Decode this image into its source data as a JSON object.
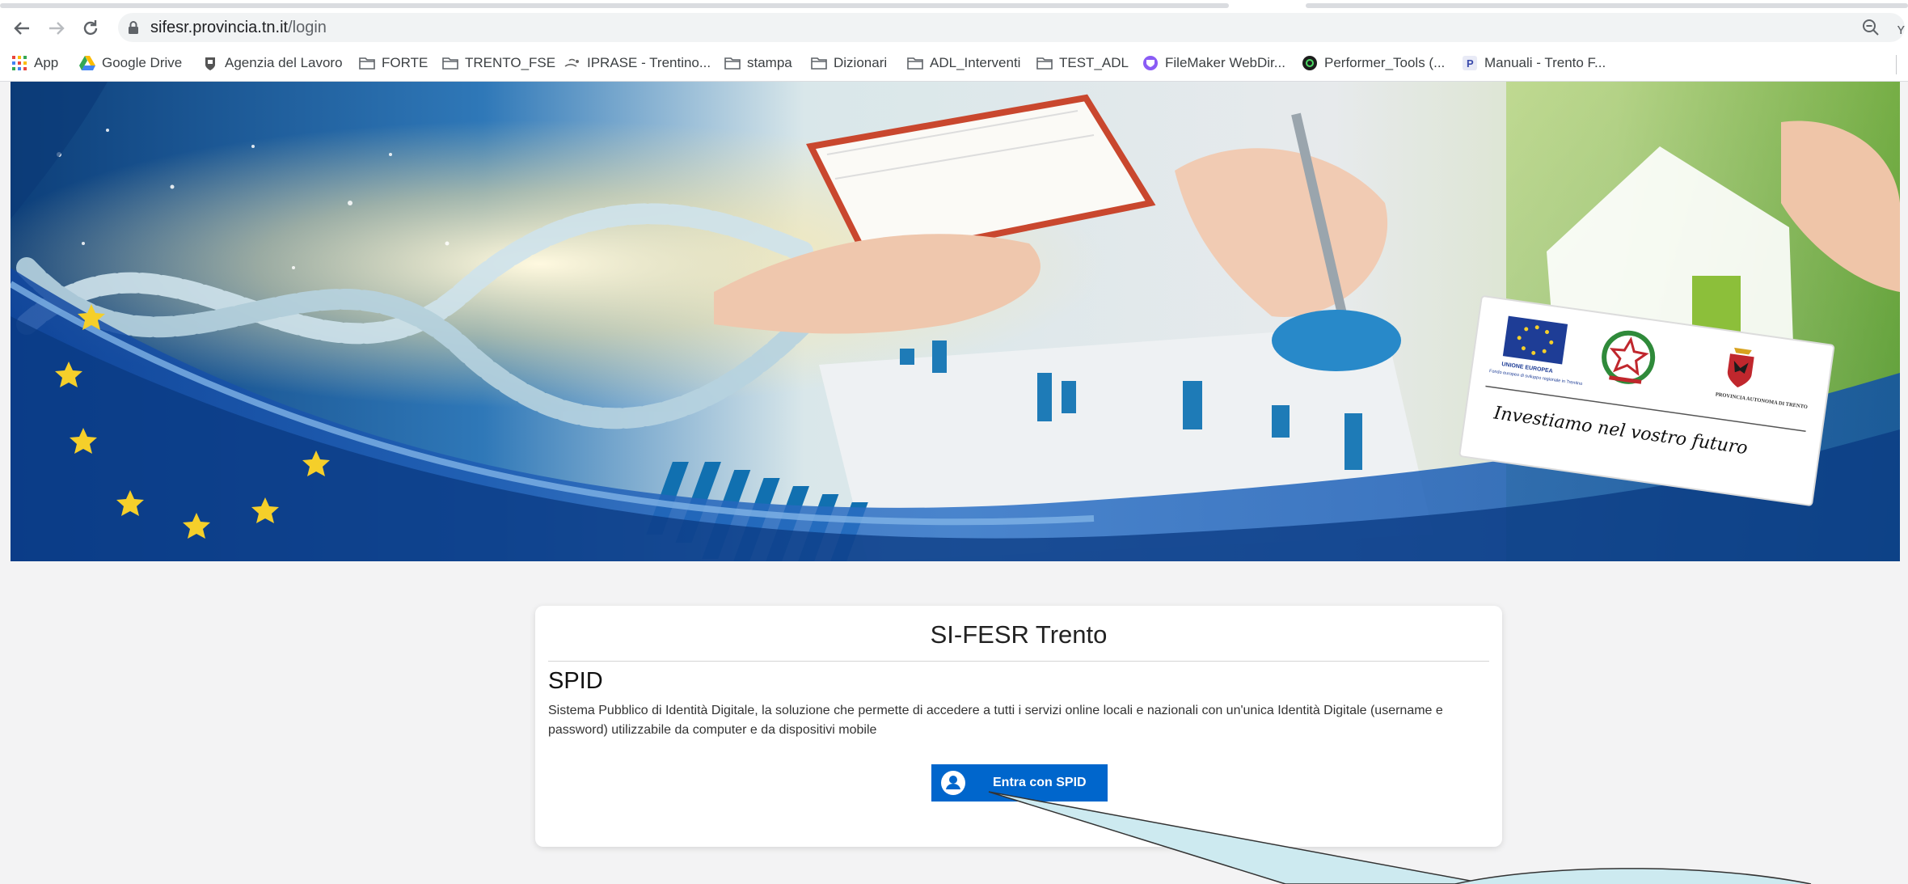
{
  "browser": {
    "url_host": "sifesr.provincia.tn.it",
    "url_path": "/login",
    "nav_icons": [
      "back-icon",
      "forward-icon",
      "reload-icon"
    ],
    "right_edge_text": "ʏ"
  },
  "bookmarks": [
    {
      "label": "App",
      "icon": "apps-grid-icon"
    },
    {
      "label": "Google Drive",
      "icon": "google-drive-icon"
    },
    {
      "label": "Agenzia del Lavoro",
      "icon": "crest-icon"
    },
    {
      "label": "FORTE",
      "icon": "folder-icon"
    },
    {
      "label": "TRENTO_FSE",
      "icon": "folder-icon"
    },
    {
      "label": "IPRASE - Trentino...",
      "icon": "iprase-icon"
    },
    {
      "label": "stampa",
      "icon": "folder-icon"
    },
    {
      "label": "Dizionari",
      "icon": "folder-icon"
    },
    {
      "label": "ADL_Interventi",
      "icon": "folder-icon"
    },
    {
      "label": "TEST_ADL",
      "icon": "folder-icon"
    },
    {
      "label": "FileMaker WebDir...",
      "icon": "filemaker-icon"
    },
    {
      "label": "Performer_Tools (...",
      "icon": "performer-icon"
    },
    {
      "label": "Manuali - Trento F...",
      "icon": "manuali-icon"
    }
  ],
  "banner": {
    "eu_label": "UNIONE EUROPEA",
    "eu_sub": "Fondo europeo di sviluppo regionale in Trentino",
    "pat_label": "PROVINCIA AUTONOMA DI TRENTO",
    "slogan": "Investiamo nel vostro futuro"
  },
  "card": {
    "title": "SI-FESR Trento",
    "heading": "SPID",
    "description": "Sistema Pubblico di Identità Digitale, la soluzione che permette di accedere a tutti i servizi online locali e nazionali con un'unica Identità Digitale (username e password) utilizzabile da computer e da dispositivi mobile",
    "button_label": "Entra con SPID"
  },
  "colors": {
    "spid_blue": "#0066cc",
    "page_bg": "#f3f3f4"
  }
}
